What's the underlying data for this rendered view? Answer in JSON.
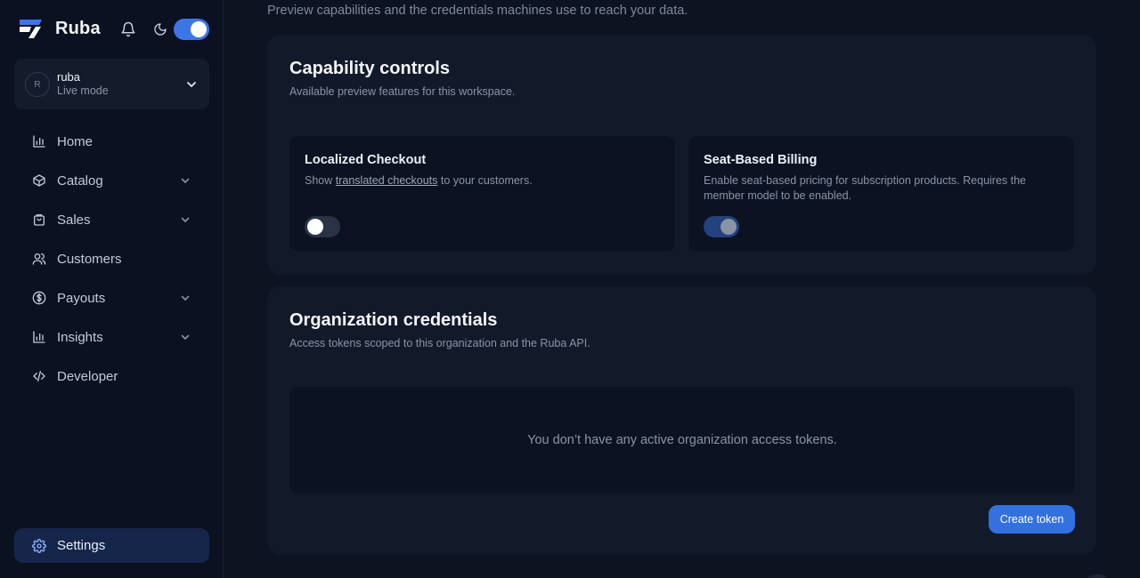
{
  "brand": {
    "name": "Ruba",
    "accent": "#3b76e8"
  },
  "org": {
    "avatar": "R",
    "name": "ruba",
    "mode": "Live mode"
  },
  "nav": [
    {
      "label": "Home",
      "icon": "bar-chart-icon",
      "expandable": false
    },
    {
      "label": "Catalog",
      "icon": "box-icon",
      "expandable": true
    },
    {
      "label": "Sales",
      "icon": "shopping-bag-icon",
      "expandable": true
    },
    {
      "label": "Customers",
      "icon": "users-icon",
      "expandable": false
    },
    {
      "label": "Payouts",
      "icon": "dollar-circle-icon",
      "expandable": true
    },
    {
      "label": "Insights",
      "icon": "bar-chart-icon",
      "expandable": true
    },
    {
      "label": "Developer",
      "icon": "code-icon",
      "expandable": false
    }
  ],
  "settings": {
    "label": "Settings",
    "icon": "gear-icon"
  },
  "page": {
    "subtitle": "Preview capabilities and the credentials machines use to reach your data."
  },
  "capabilities": {
    "title": "Capability controls",
    "description": "Available preview features for this workspace.",
    "features": [
      {
        "title": "Localized Checkout",
        "desc_before": "Show ",
        "desc_link": "translated checkouts",
        "desc_after": " to your customers.",
        "enabled": false
      },
      {
        "title": "Seat-Based Billing",
        "desc_before": "Enable seat-based pricing for subscription products. Requires the member model to be enabled.",
        "desc_link": "",
        "desc_after": "",
        "enabled": true
      }
    ]
  },
  "credentials": {
    "title": "Organization credentials",
    "description": "Access tokens scoped to this organization and the Ruba API.",
    "empty_text": "You don’t have any active organization access tokens.",
    "create_label": "Create token"
  }
}
